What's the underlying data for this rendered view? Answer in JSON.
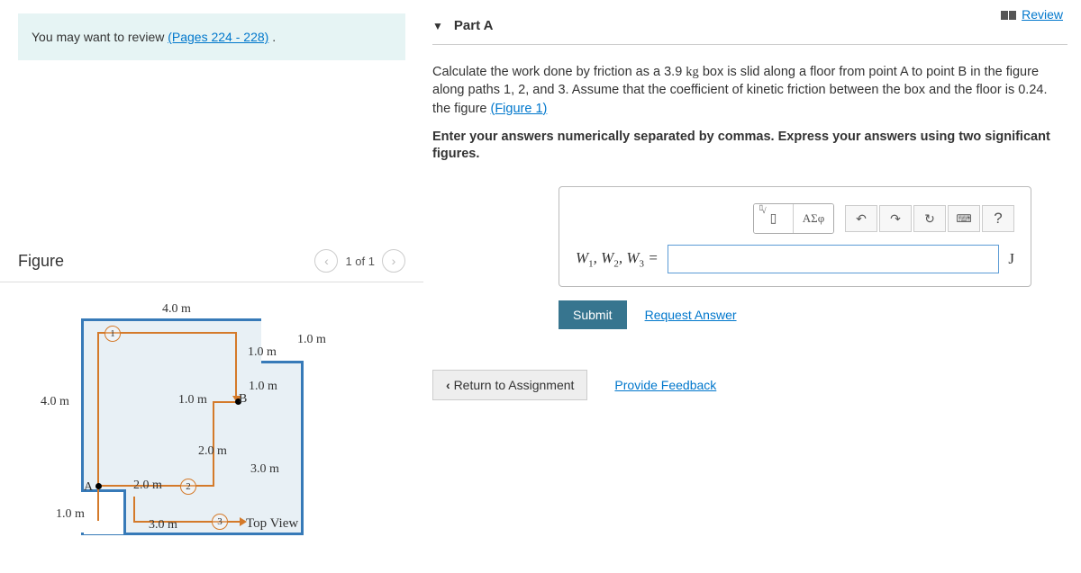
{
  "review_link": "Review",
  "hint": {
    "prefix": "You may want to review ",
    "link": "(Pages 224 - 228)",
    "suffix": " ."
  },
  "figure": {
    "title": "Figure",
    "pager": "1 of 1",
    "labels": {
      "top40": "4.0 m",
      "left40": "4.0 m",
      "step10a": "1.0 m",
      "step10b": "1.0 m",
      "step10c": "1.0 m",
      "step10d": "1.0 m",
      "mid20v": "2.0 m",
      "right30": "3.0 m",
      "mid20h": "2.0 m",
      "bottom10": "1.0 m",
      "bottom30": "3.0 m",
      "ptA": "A",
      "ptB": "B",
      "c1": "1",
      "c2": "2",
      "c3": "3",
      "topview": "Top View"
    }
  },
  "part": {
    "title": "Part A",
    "question_pre": "Calculate the work done by friction as a 3.9 ",
    "kg": "kg",
    "question_mid": " box is slid along a floor from point A to point B in the figure along paths 1, 2, and 3. Assume that the coefficient of kinetic friction between the box and the floor is 0.24. the figure ",
    "figlink": "(Figure 1)",
    "instruction": "Enter your answers numerically separated by commas. Express your answers using two significant figures.",
    "var_label": "W₁, W₂, W₃ =",
    "unit": "J",
    "toolbar": {
      "greek": "ΑΣφ",
      "help": "?"
    },
    "submit": "Submit",
    "request": "Request Answer"
  },
  "footer": {
    "return": "Return to Assignment",
    "feedback": "Provide Feedback"
  }
}
